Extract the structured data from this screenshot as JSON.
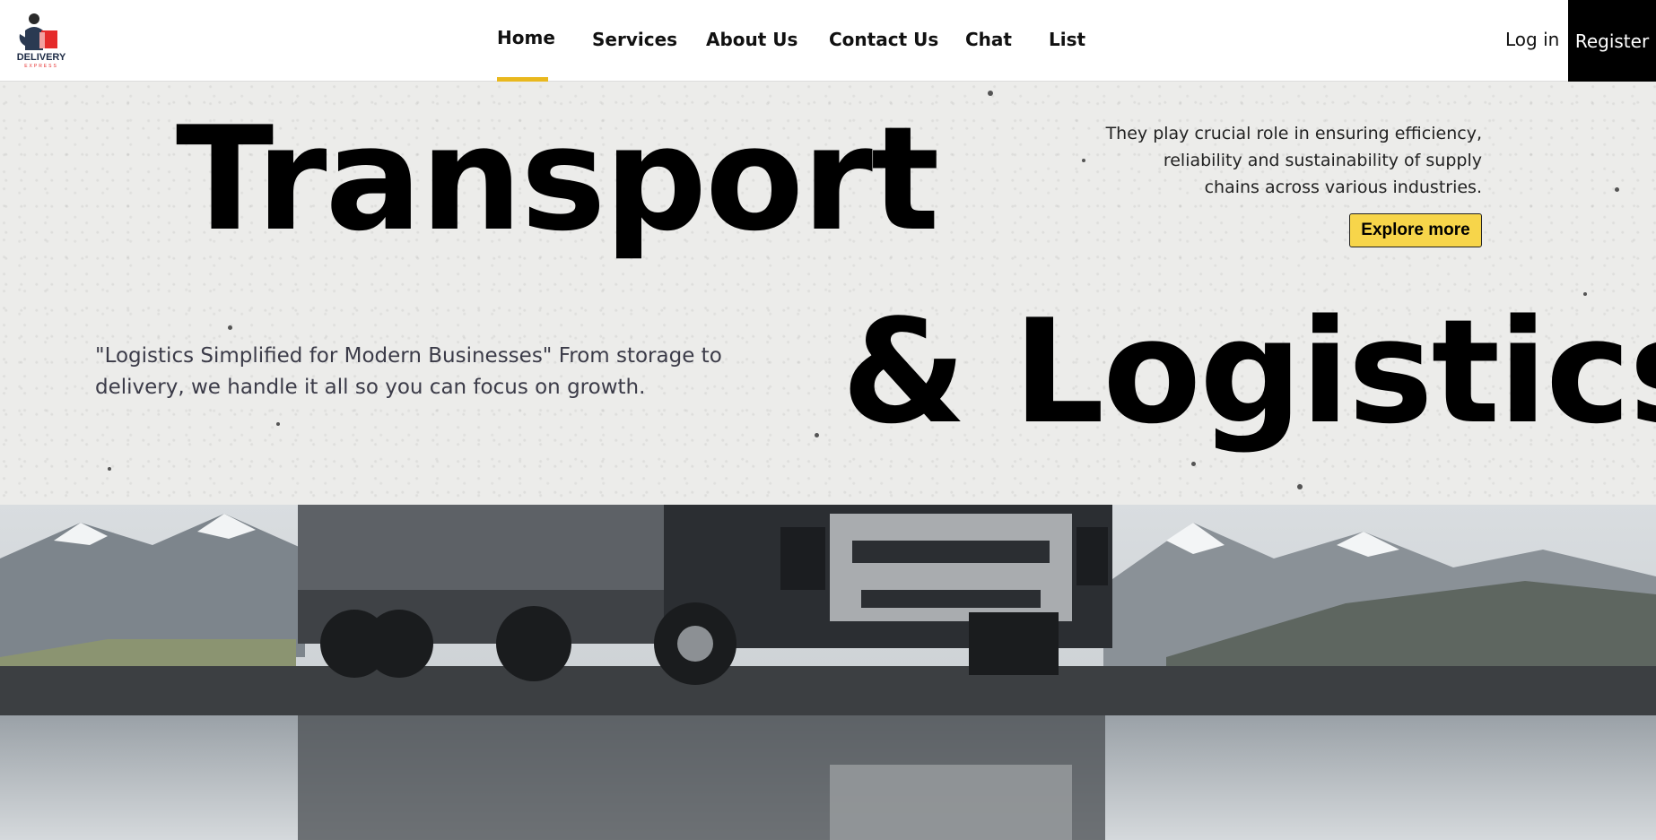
{
  "brand": {
    "logo_text": "DELIVERY",
    "logo_sub": "EXPRESS"
  },
  "nav": {
    "items": [
      {
        "label": "Home",
        "active": true
      },
      {
        "label": "Services",
        "active": false
      },
      {
        "label": "About Us",
        "active": false
      },
      {
        "label": "Contact Us",
        "active": false
      },
      {
        "label": "Chat",
        "active": false
      },
      {
        "label": "List",
        "active": false
      }
    ],
    "login_label": "Log in",
    "register_label": "Register"
  },
  "hero": {
    "title_line1": "Transport",
    "title_line2": "& Logistics",
    "description": "They play crucial role in ensuring efficiency, reliability and sustainability of supply chains across various industries.",
    "explore_label": "Explore more",
    "tagline": "\"Logistics Simplified for Modern Businesses\" From storage to delivery, we handle it all so you can focus on growth."
  },
  "colors": {
    "accent": "#e9b81e",
    "button": "#f7d54a",
    "register_bg": "#000000"
  },
  "icons": {
    "logo": "delivery-man-icon"
  }
}
